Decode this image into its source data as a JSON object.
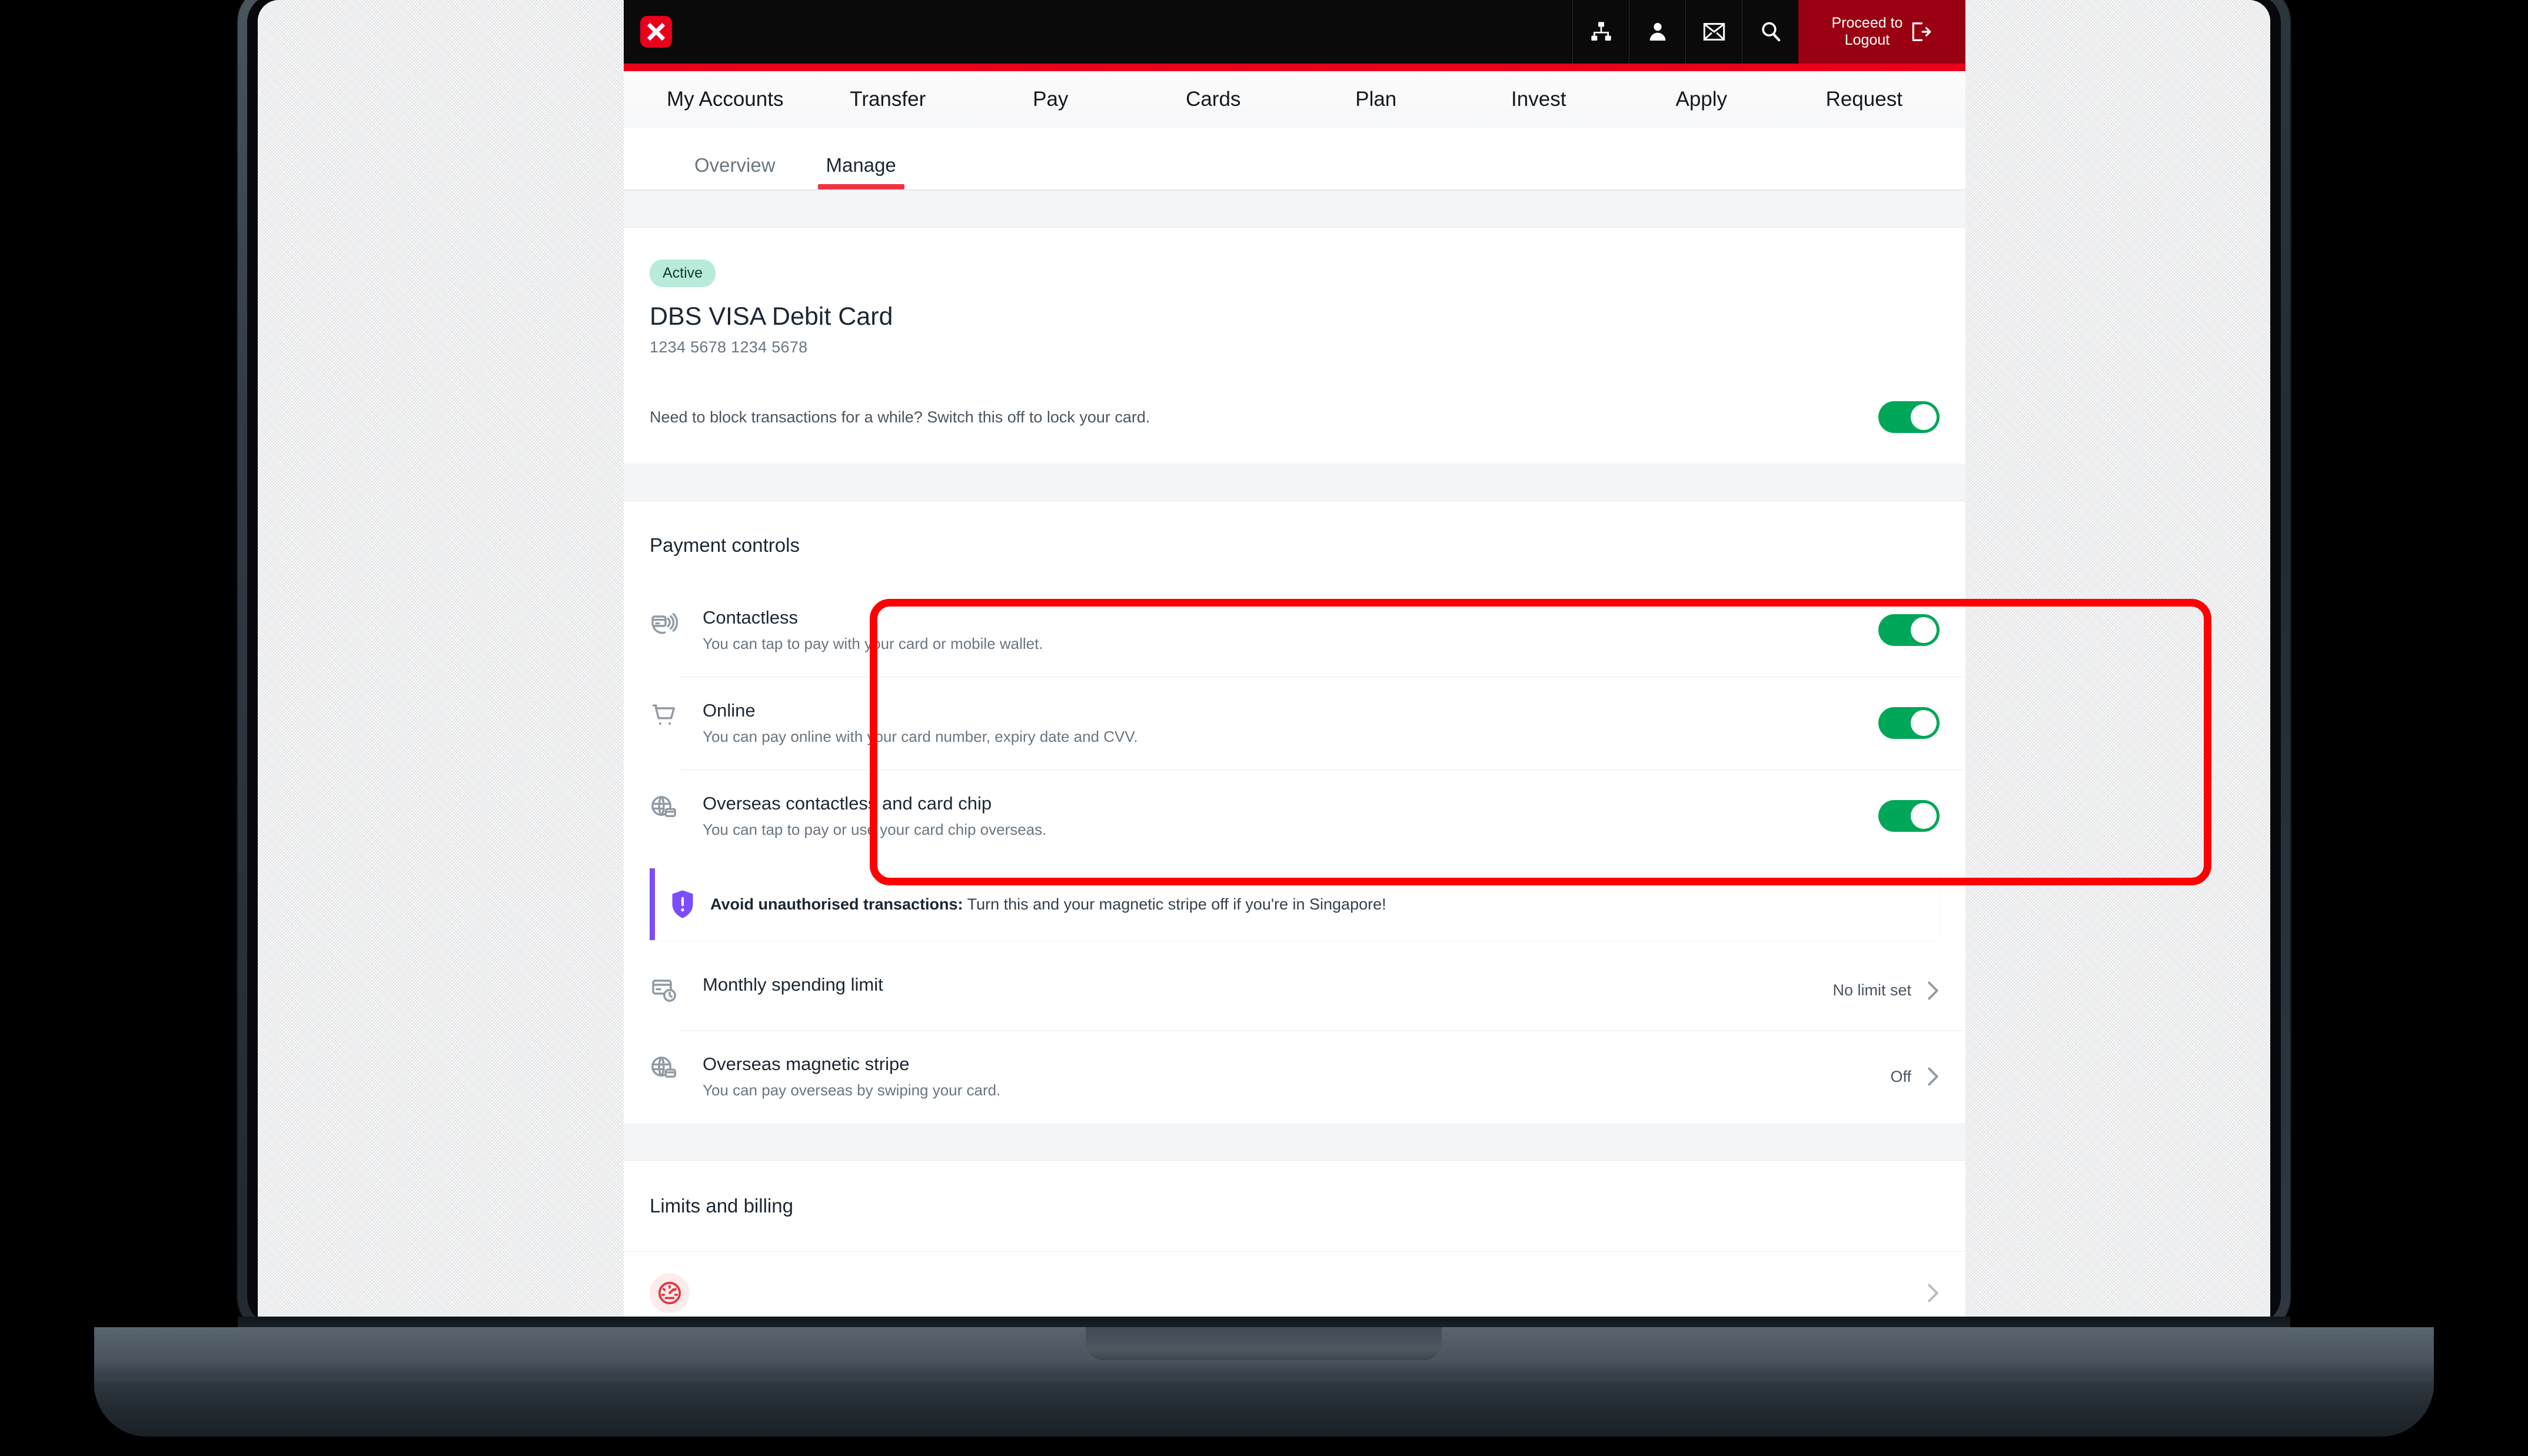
{
  "topbar": {
    "logo_name": "dbs-logo",
    "icons": [
      {
        "name": "sitemap-icon",
        "label": "Sitemap"
      },
      {
        "name": "person-icon",
        "label": "Profile"
      },
      {
        "name": "envelope-icon",
        "label": "Messages"
      },
      {
        "name": "search-icon",
        "label": "Search"
      }
    ],
    "logout_label": "Proceed to\nLogout"
  },
  "mainnav": {
    "items": [
      {
        "label": "My Accounts"
      },
      {
        "label": "Transfer"
      },
      {
        "label": "Pay"
      },
      {
        "label": "Cards"
      },
      {
        "label": "Plan"
      },
      {
        "label": "Invest"
      },
      {
        "label": "Apply"
      },
      {
        "label": "Request"
      }
    ]
  },
  "subtabs": {
    "items": [
      {
        "label": "Overview",
        "active": false
      },
      {
        "label": "Manage",
        "active": true
      }
    ]
  },
  "card": {
    "status_badge": "Active",
    "title": "DBS VISA Debit Card",
    "number": "1234 5678 1234 5678",
    "lock_text": "Need to block transactions for a while? Switch this off to lock your card.",
    "lock_toggle_on": true
  },
  "payment_controls": {
    "heading": "Payment controls",
    "rows": [
      {
        "icon": "contactless-card-icon",
        "title": "Contactless",
        "subtitle": "You can tap to pay with your card or mobile wallet.",
        "toggle_on": true
      },
      {
        "icon": "shopping-cart-icon",
        "title": "Online",
        "subtitle": "You can pay online with your card number, expiry date and CVV.",
        "toggle_on": true
      },
      {
        "icon": "globe-card-icon",
        "title": "Overseas contactless and card chip",
        "subtitle": "You can tap to pay or use your card chip overseas.",
        "toggle_on": true
      }
    ],
    "alert": {
      "icon": "shield-alert-icon",
      "bold_text": "Avoid unauthorised transactions:",
      "text": " Turn this and your magnetic stripe off if you're in Singapore!"
    },
    "link_rows": [
      {
        "icon": "card-clock-icon",
        "title": "Monthly spending limit",
        "subtitle": "",
        "value": "No limit set"
      },
      {
        "icon": "globe-card-icon",
        "title": "Overseas magnetic stripe",
        "subtitle": "You can pay overseas by swiping your card.",
        "value": "Off"
      }
    ]
  },
  "limits_billing": {
    "heading": "Limits and billing",
    "rows": [
      {
        "icon": "speedometer-icon",
        "title": "",
        "value": ""
      }
    ]
  },
  "colors": {
    "brand_red": "#e8001c",
    "accent_red": "#ef3340",
    "toggle_green": "#00a758",
    "badge_green_bg": "#b8ecd9",
    "alert_purple": "#7c4dff",
    "annotation_red": "#ff0000"
  }
}
